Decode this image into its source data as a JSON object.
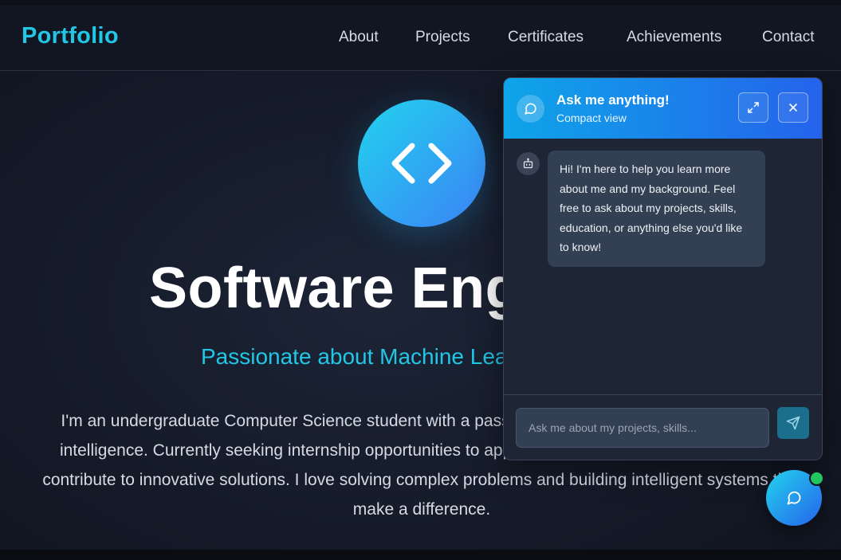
{
  "nav": {
    "logo": "Portfolio",
    "links": [
      "About",
      "Projects",
      "Certificates",
      "Achievements",
      "Contact"
    ]
  },
  "hero": {
    "icon": "code-icon",
    "title": "Software Engineer",
    "subtitle": "Passionate about Machine Learning",
    "description": "I'm an undergraduate Computer Science student with a passion for machine learning and artificial intelligence. Currently seeking internship opportunities to apply my skills in real-world projects and contribute to innovative solutions. I love solving complex problems and building intelligent systems that make a difference."
  },
  "chat": {
    "title": "Ask me anything!",
    "subtitle": "Compact view",
    "header_icon": "message-circle-icon",
    "expand_icon": "expand-icon",
    "close_icon": "close-icon",
    "bot_icon": "bot-icon",
    "message": "Hi! I'm here to help you learn more about me and my background. Feel free to ask about my projects, skills, education, or anything else you'd like to know!",
    "input_placeholder": "Ask me about my projects, skills...",
    "send_icon": "send-icon"
  },
  "fab": {
    "icon": "message-circle-icon",
    "status": "online"
  },
  "colors": {
    "accent": "#22c7e6",
    "gradient_start": "#22d3ee",
    "gradient_end": "#2563eb",
    "background": "#141a28",
    "online": "#22c55e"
  }
}
